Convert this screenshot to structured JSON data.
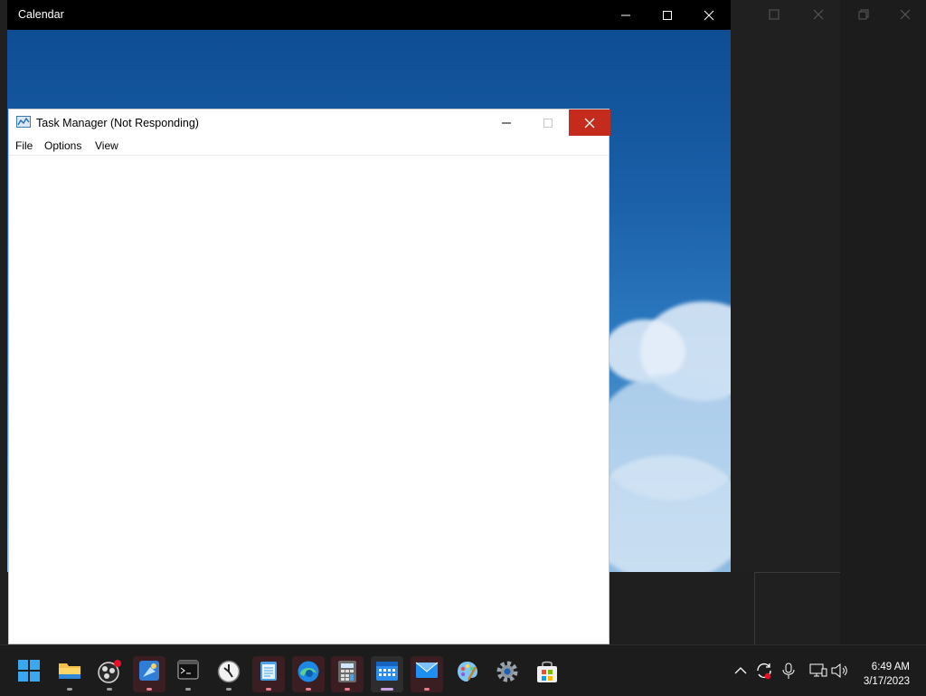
{
  "calendar_window": {
    "title": "Calendar"
  },
  "task_manager": {
    "title": "Task Manager (Not Responding)",
    "menu": [
      "File",
      "Options",
      "View"
    ]
  },
  "taskbar": {
    "apps": [
      {
        "name": "Start",
        "icon": "windows-logo-icon"
      },
      {
        "name": "File Explorer",
        "icon": "folder-icon"
      },
      {
        "name": "OBS",
        "icon": "obs-icon",
        "badge": true
      },
      {
        "name": "Paint",
        "icon": "paint-icon"
      },
      {
        "name": "Terminal",
        "icon": "terminal-icon"
      },
      {
        "name": "Clock",
        "icon": "clock-icon"
      },
      {
        "name": "Notepad",
        "icon": "notepad-icon"
      },
      {
        "name": "Edge",
        "icon": "edge-icon"
      },
      {
        "name": "Calculator",
        "icon": "calculator-icon"
      },
      {
        "name": "Calendar",
        "icon": "calendar-icon"
      },
      {
        "name": "Mail",
        "icon": "mail-icon"
      },
      {
        "name": "Paint 3D",
        "icon": "palette-icon"
      },
      {
        "name": "Settings",
        "icon": "gear-icon"
      },
      {
        "name": "Store",
        "icon": "store-icon"
      }
    ],
    "clock": {
      "time": "6:49 AM",
      "date": "3/17/2023"
    }
  },
  "colors": {
    "close_red": "#c42b1c",
    "taskbar": "#1c1c1c",
    "sky": "#1a5fa8"
  }
}
